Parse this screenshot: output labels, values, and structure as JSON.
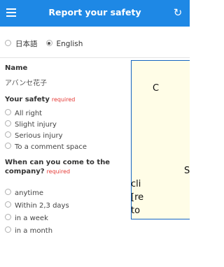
{
  "header": {
    "title": "Report your safety",
    "menu_icon": "hamburger-menu-icon",
    "reload_icon": "reload-icon",
    "reload_glyph": "↻",
    "background_color": "#1e88e5"
  },
  "language": {
    "options": [
      {
        "label": "日本語",
        "selected": false
      },
      {
        "label": "English",
        "selected": true
      }
    ]
  },
  "name": {
    "label": "Name",
    "value": "アバンセ花子"
  },
  "safety": {
    "label": "Your safety",
    "required_text": "required",
    "options": [
      {
        "label": "All right",
        "selected": false
      },
      {
        "label": "Slight injury",
        "selected": false
      },
      {
        "label": "Serious injury",
        "selected": false
      },
      {
        "label": "To a comment space",
        "selected": false
      }
    ]
  },
  "arrival": {
    "label_line1": "When can you come to the",
    "label_line2": "company?",
    "required_text": "required",
    "options": [
      {
        "label": "anytime",
        "selected": false
      },
      {
        "label": "Within 2,3 days",
        "selected": false
      },
      {
        "label": "in a week",
        "selected": false
      },
      {
        "label": "in a month",
        "selected": false
      }
    ]
  },
  "popup": {
    "line1": "C",
    "line2": "S",
    "line3": "cli",
    "line4": "[re",
    "line5": "to"
  },
  "colors": {
    "required": "#e53935",
    "popup_border": "#1565c0",
    "popup_background": "#fffde7"
  }
}
